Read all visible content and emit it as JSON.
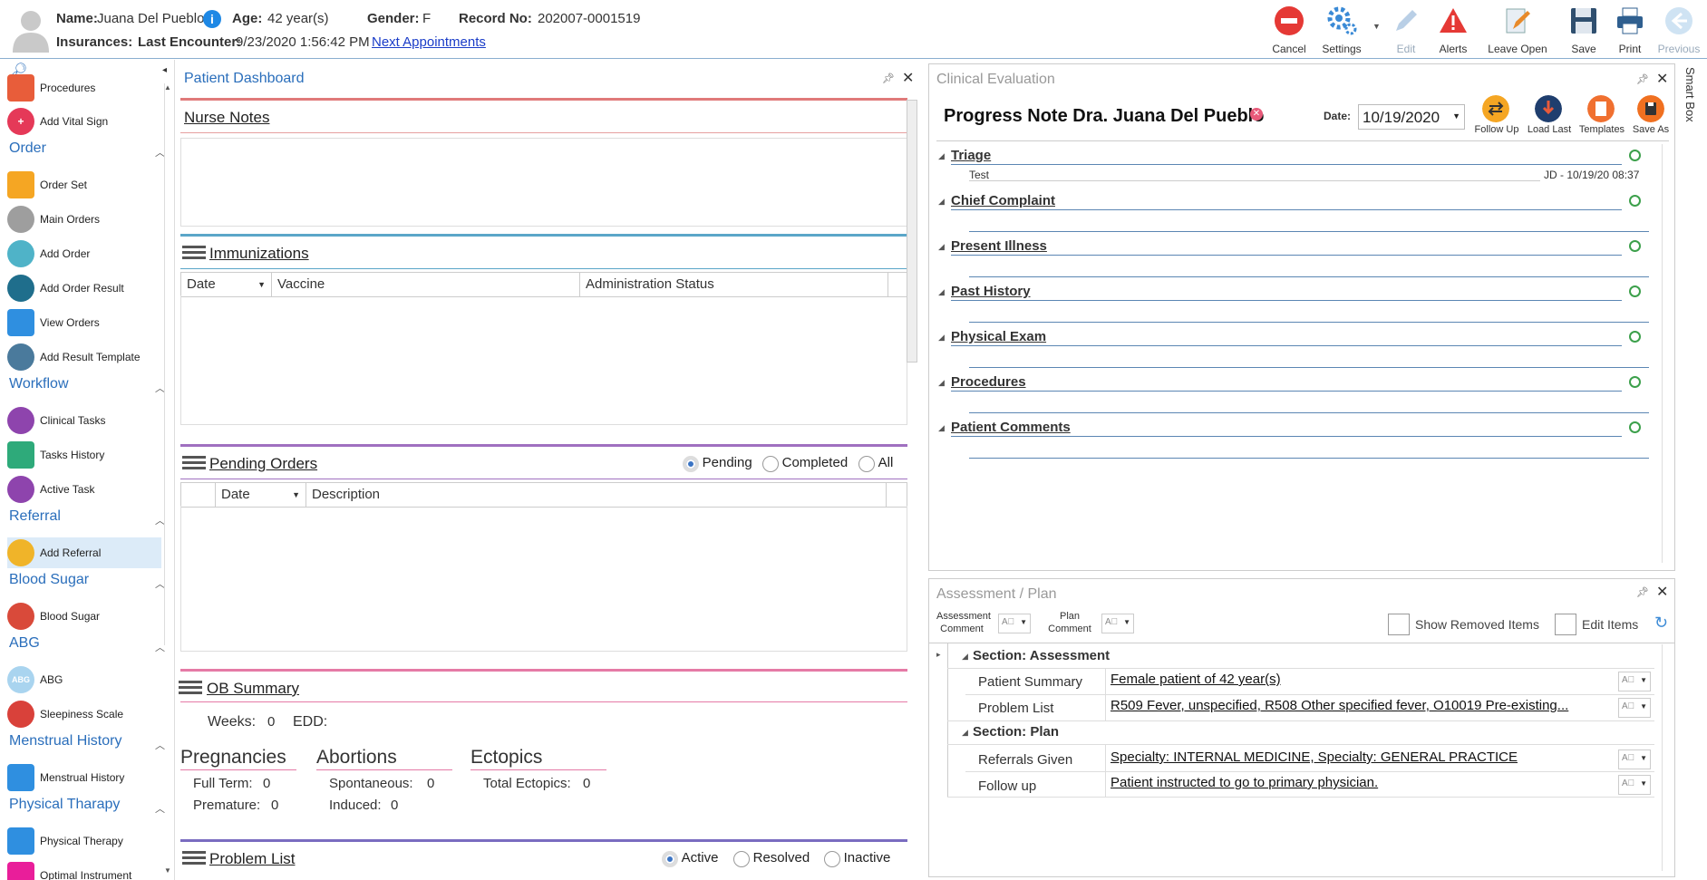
{
  "header": {
    "name_label": "Name:",
    "name": "Juana Del Pueblo",
    "age_label": "Age:",
    "age": "42 year(s)",
    "gender_label": "Gender:",
    "gender": "F",
    "record_label": "Record No:",
    "record": "202007-0001519",
    "insurances_label": "Insurances:",
    "last_encounter_label": "Last Encounter:",
    "last_encounter": "9/23/2020 1:56:42 PM",
    "next_appointments": "Next Appointments"
  },
  "toolbar": {
    "cancel": "Cancel",
    "settings": "Settings",
    "edit": "Edit",
    "alerts": "Alerts",
    "leave_open": "Leave Open",
    "save": "Save",
    "print": "Print",
    "previous": "Previous"
  },
  "sidebar": {
    "procedures": "Procedures",
    "add_vital_sign": "Add Vital Sign",
    "order_head": "Order",
    "order_set": "Order Set",
    "main_orders": "Main Orders",
    "add_order": "Add Order",
    "add_order_result": "Add Order Result",
    "view_orders": "View Orders",
    "add_result_template": "Add Result Template",
    "workflow_head": "Workflow",
    "clinical_tasks": "Clinical Tasks",
    "tasks_history": "Tasks History",
    "active_task": "Active Task",
    "referral_head": "Referral",
    "add_referral": "Add Referral",
    "blood_sugar_head": "Blood Sugar",
    "blood_sugar": "Blood Sugar",
    "abg_head": "ABG",
    "abg": "ABG",
    "abg_icon_text": "ABG",
    "sleepiness_scale": "Sleepiness Scale",
    "menstrual_head": "Menstrual History",
    "menstrual_history": "Menstrual History",
    "physical_head": "Physical Tharapy",
    "physical_therapy": "Physical Therapy",
    "optimal_instrument": "Optimal Instrument"
  },
  "dashboard": {
    "title": "Patient Dashboard",
    "nurse_notes": "Nurse Notes",
    "immunizations": "Immunizations",
    "imm_cols": [
      "Date",
      "Vaccine",
      "Administration Status"
    ],
    "pending_orders": "Pending Orders",
    "po_filters": [
      "Pending",
      "Completed",
      "All"
    ],
    "po_cols": [
      "Date",
      "Description"
    ],
    "ob_summary": "OB Summary",
    "weeks_label": "Weeks:",
    "weeks": "0",
    "edd_label": "EDD:",
    "pregnancies": "Pregnancies",
    "full_term_label": "Full Term:",
    "full_term": "0",
    "premature_label": "Premature:",
    "premature": "0",
    "abortions": "Abortions",
    "spontaneous_label": "Spontaneous:",
    "spontaneous": "0",
    "induced_label": "Induced:",
    "induced": "0",
    "ectopics": "Ectopics",
    "total_ectopics_label": "Total Ectopics:",
    "total_ectopics": "0",
    "problem_list": "Problem List",
    "pl_filters": [
      "Active",
      "Resolved",
      "Inactive"
    ]
  },
  "clinical": {
    "title": "Clinical Evaluation",
    "note_title": "Progress Note Dra. Juana Del Pueblo",
    "date_label": "Date:",
    "date": "10/19/2020",
    "btns": [
      "Follow Up",
      "Load Last",
      "Templates",
      "Save As"
    ],
    "sections": [
      "Triage",
      "Chief Complaint",
      "Present Illness",
      "Past History",
      "Physical Exam",
      "Procedures",
      "Patient Comments"
    ],
    "triage_entry": "Test",
    "triage_stamp": "JD - 10/19/20 08:37"
  },
  "smart_box": "Smart Box",
  "assessment": {
    "title": "Assessment / Plan",
    "assessment_comment": "Assessment Comment",
    "plan_comment": "Plan Comment",
    "show_removed": "Show Removed Items",
    "edit_items": "Edit Items",
    "section_assessment": "Section: Assessment",
    "patient_summary_label": "Patient Summary",
    "patient_summary": "Female patient of 42 year(s)",
    "problem_list_label": "Problem List",
    "problem_list": "R509 Fever, unspecified, R508 Other specified fever, O10019 Pre-existing...",
    "section_plan": "Section: Plan",
    "referrals_label": "Referrals Given",
    "referrals": "Specialty: INTERNAL MEDICINE, Specialty: GENERAL PRACTICE",
    "follow_up_label": "Follow up",
    "follow_up": "Patient instructed to go to primary physician."
  },
  "colors": {
    "accent_blue": "#2a6ebb",
    "nurse_bar": "#e07a7a",
    "imm_bar": "#5aa6c8",
    "pending_bar": "#a070c0",
    "ob_bar": "#e57aa6",
    "problem_bar": "#7a6cc0"
  }
}
